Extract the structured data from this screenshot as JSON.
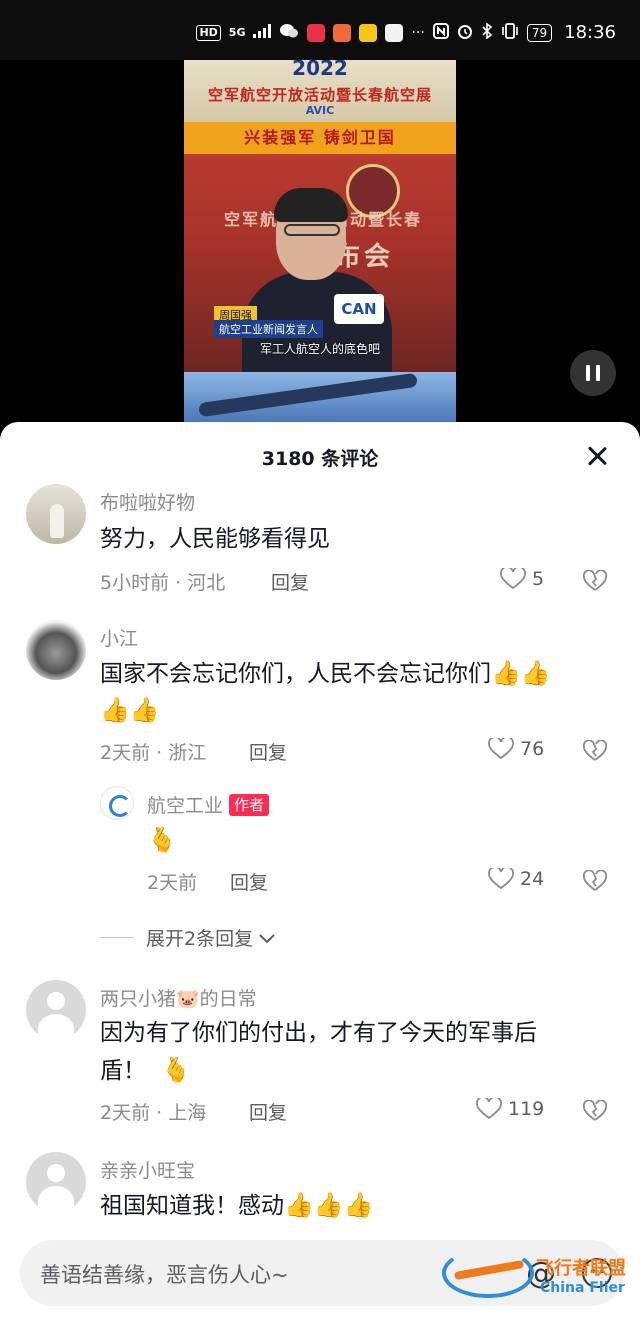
{
  "status_bar": {
    "hd": "HD",
    "network": "5G",
    "battery": "79",
    "time": "18:36",
    "more": "···"
  },
  "video": {
    "banner_year": "2022",
    "banner_title": "空军航空开放活动暨长春航空展",
    "banner_logo": "AVIC",
    "slogan": "兴装强军  铸剑卫国",
    "bg_text_1": "空军航空开放活动暨长春",
    "bg_text_2": "发布会",
    "mic_label": "CAN",
    "name_tag": "周国强",
    "role_tag": "航空工业新闻发言人",
    "caption": "军工人航空人的底色吧"
  },
  "comments_panel": {
    "title": "3180 条评论",
    "comments": [
      {
        "name": "布啦啦好物",
        "text": "努力，人民能够看得见",
        "time_location": "5小时前 · 河北",
        "reply_label": "回复",
        "likes": "5"
      },
      {
        "name": "小江",
        "text_line1": "国家不会忘记你们，人民不会忘记你们",
        "text_line1_emoji": "👍👍",
        "text_line2_emoji": "👍👍",
        "time_location": "2天前 · 浙江",
        "reply_label": "回复",
        "likes": "76"
      },
      {
        "name": "两只小猪🐷的日常",
        "text_line1": "因为有了你们的付出，才有了今天的军事后",
        "text_line2": "盾！",
        "text_emoji": "🫰",
        "time_location": "2天前 · 上海",
        "reply_label": "回复",
        "likes": "119"
      },
      {
        "name": "亲亲小旺宝",
        "text": "祖国知道我！感动",
        "text_emoji": "👍👍👍"
      }
    ],
    "reply": {
      "name": "航空工业",
      "badge": "作者",
      "emoji": "🫰",
      "time": "2天前",
      "reply_label": "回复",
      "likes": "24"
    },
    "expand_label": "展开2条回复"
  },
  "input_bar": {
    "placeholder": "善语结善缘，恶言伤人心~",
    "at_symbol": "@"
  },
  "watermark": {
    "cn": "飞行者联盟",
    "en": "China Flier"
  },
  "colors": {
    "author_badge": "#fe2c55",
    "text_primary": "#161823",
    "text_secondary": "#8a8b91"
  }
}
